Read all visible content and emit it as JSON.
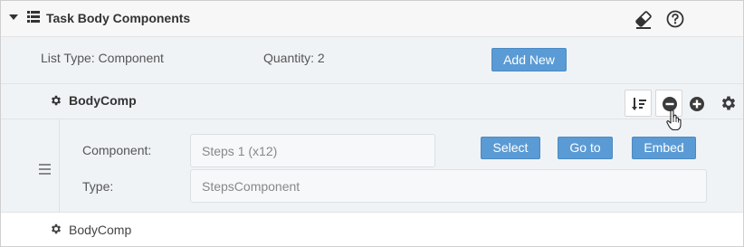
{
  "header": {
    "title": "Task Body Components",
    "caret_icon": "caret-down-icon",
    "list_icon": "list-icon",
    "eraser_icon": "eraser-icon",
    "help_icon": "help-circle-icon"
  },
  "info": {
    "list_type": "List Type: Component",
    "quantity": "Quantity: 2",
    "add_new_label": "Add New"
  },
  "items": [
    {
      "title": "BodyComp",
      "component_label": "Component:",
      "component_value": "Steps 1 (x12)",
      "type_label": "Type:",
      "type_value": "StepsComponent",
      "select_label": "Select",
      "goto_label": "Go to",
      "embed_label": "Embed"
    },
    {
      "title": "BodyComp"
    }
  ],
  "colors": {
    "accent": "#5b9bd5",
    "panel": "#f0f3f6",
    "header_bg": "#f7f7f7"
  }
}
